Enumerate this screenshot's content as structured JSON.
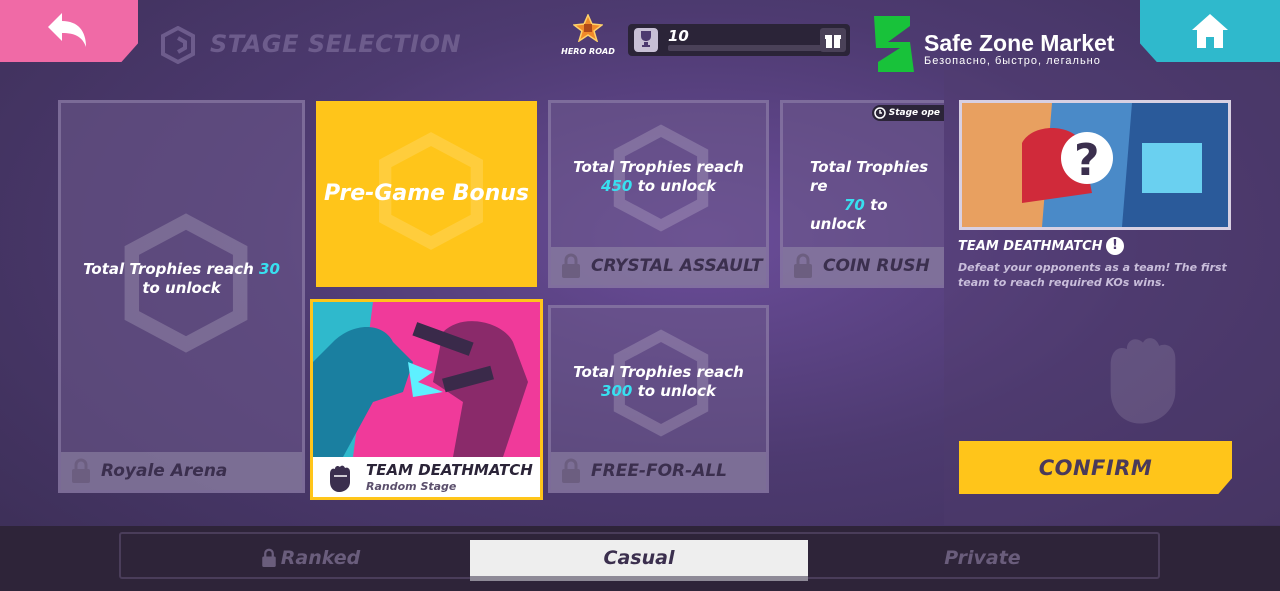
{
  "header": {
    "title": "STAGE SELECTION",
    "hero_road_label": "HERO ROAD",
    "trophy_count": "10",
    "trophy_progress": 0,
    "brand_name": "Safe Zone Market",
    "brand_tagline": "Безопасно, быстро, легально"
  },
  "stages": {
    "royale": {
      "unlock_prefix": "Total Trophies reach ",
      "trophies": "30",
      "unlock_suffix": "to unlock",
      "name": "Royale Arena"
    },
    "bonus": {
      "label": "Pre-Game Bonus"
    },
    "crystal": {
      "unlock_prefix": "Total Trophies reach",
      "trophies": "450",
      "unlock_suffix": " to unlock",
      "name": "CRYSTAL ASSAULT"
    },
    "coin": {
      "unlock_prefix": "Total Trophies re",
      "trophies": "70",
      "unlock_suffix": " to unlock",
      "name": "COIN RUSH",
      "badge": "Stage ope"
    },
    "tdm": {
      "name": "TEAM DEATHMATCH",
      "sub": "Random Stage"
    },
    "ffa": {
      "unlock_prefix": "Total Trophies reach",
      "trophies": "300",
      "unlock_suffix": " to unlock",
      "name": "FREE-FOR-ALL"
    }
  },
  "details": {
    "mode_name": "TEAM DEATHMATCH",
    "info_glyph": "!",
    "description": "Defeat your opponents as a team! The first team to reach required KOs wins.",
    "confirm_label": "CONFIRM"
  },
  "tabs": [
    {
      "label": "Ranked",
      "locked": true,
      "active": false
    },
    {
      "label": "Casual",
      "locked": false,
      "active": true
    },
    {
      "label": "Private",
      "locked": false,
      "active": false
    }
  ],
  "colors": {
    "accent_yellow": "#ffc51a",
    "back_pink": "#f06aa6",
    "home_cyan": "#2fb9cc",
    "trophy_cyan": "#38e0f0"
  }
}
